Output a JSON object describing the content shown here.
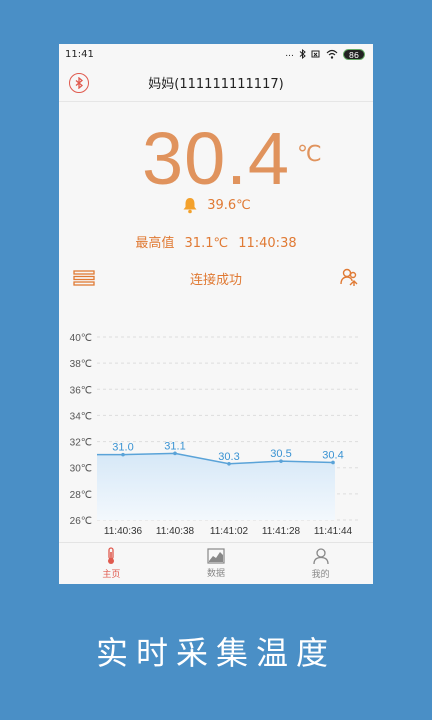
{
  "status_bar": {
    "time": "11:41",
    "dots": "...",
    "battery": "86"
  },
  "header": {
    "title": "妈妈(111111111117)",
    "bluetooth_icon": "bluetooth-icon"
  },
  "reading": {
    "value": "30.4",
    "unit": "℃"
  },
  "alarm": {
    "icon": "bell-icon",
    "threshold": "39.6℃"
  },
  "max": {
    "label": "最高值",
    "value": "31.1℃",
    "time": "11:40:38"
  },
  "connection": {
    "status": "连接成功",
    "left_icon": "list-icon",
    "right_icon": "users-icon"
  },
  "chart_data": {
    "type": "area",
    "x": [
      "11:40:36",
      "11:40:38",
      "11:41:02",
      "11:41:28",
      "11:41:44"
    ],
    "values": [
      31.0,
      31.1,
      30.3,
      30.5,
      30.4
    ],
    "data_labels": [
      "31.0",
      "31.1",
      "30.3",
      "30.5",
      "30.4"
    ],
    "y_ticks": [
      "40℃",
      "38℃",
      "36℃",
      "34℃",
      "32℃",
      "30℃",
      "28℃",
      "26℃"
    ],
    "ylim": [
      26,
      40
    ],
    "grid": true,
    "colors": {
      "line": "#5aa3d8",
      "fill": "#d6e8f7",
      "label": "#3a93d3",
      "tick": "#555555"
    }
  },
  "tabs": [
    {
      "label": "主页",
      "icon": "thermometer-icon",
      "active": true
    },
    {
      "label": "数据",
      "icon": "chart-icon",
      "active": false
    },
    {
      "label": "我的",
      "icon": "profile-icon",
      "active": false
    }
  ],
  "caption": "实时采集温度",
  "colors": {
    "accent": "#e0935d",
    "orange_text": "#e07a34",
    "bluetooth": "#e05a4e",
    "background": "#4a8fc6"
  }
}
